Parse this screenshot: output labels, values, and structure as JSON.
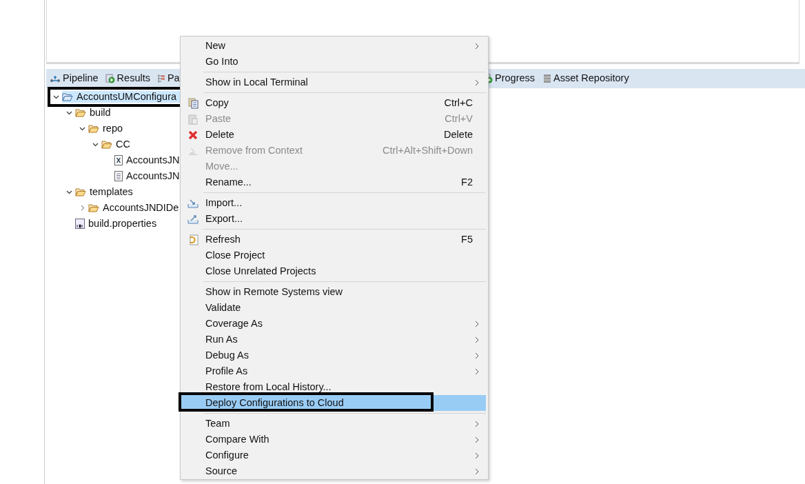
{
  "view_tabs": {
    "left": [
      {
        "label": "Pipeline",
        "kind": "pipeline"
      },
      {
        "label": "Results",
        "kind": "results"
      },
      {
        "label": "Pa",
        "kind": "grid"
      }
    ],
    "right": [
      {
        "label": "Progress",
        "kind": "results"
      },
      {
        "label": "Asset Repository",
        "kind": "repo"
      }
    ]
  },
  "tree": [
    {
      "label": "AccountsUMConfigura",
      "kind": "project",
      "expanded": true,
      "selected": true,
      "children": [
        {
          "label": "build",
          "kind": "folder",
          "expanded": true,
          "selected": false,
          "children": [
            {
              "label": "repo",
              "kind": "folder",
              "expanded": true,
              "selected": false,
              "children": [
                {
                  "label": "CC",
                  "kind": "folder",
                  "expanded": true,
                  "selected": false,
                  "children": [
                    {
                      "label": "AccountsJN",
                      "kind": "xml",
                      "selected": false
                    },
                    {
                      "label": "AccountsJN",
                      "kind": "text",
                      "selected": false
                    }
                  ]
                }
              ]
            }
          ]
        },
        {
          "label": "templates",
          "kind": "folder",
          "expanded": true,
          "selected": false,
          "children": [
            {
              "label": "AccountsJNDIDe",
              "kind": "folder",
              "expanded": false,
              "selected": false
            }
          ]
        },
        {
          "label": "build.properties",
          "kind": "binary",
          "selected": false
        }
      ]
    }
  ],
  "context_menu": {
    "groups": [
      [
        {
          "label": "New",
          "submenu": true,
          "disabled": false,
          "selected": false
        },
        {
          "label": "Go Into",
          "submenu": false,
          "disabled": false,
          "selected": false
        }
      ],
      [
        {
          "label": "Show in Local Terminal",
          "submenu": true,
          "disabled": false,
          "selected": false
        }
      ],
      [
        {
          "label": "Copy",
          "kind": "copy",
          "shortcut": "Ctrl+C",
          "submenu": false,
          "disabled": false,
          "selected": false
        },
        {
          "label": "Paste",
          "kind": "paste",
          "shortcut": "Ctrl+V",
          "submenu": false,
          "disabled": true,
          "selected": false
        },
        {
          "label": "Delete",
          "kind": "delete",
          "shortcut": "Delete",
          "submenu": false,
          "disabled": false,
          "selected": false
        },
        {
          "label": "Remove from Context",
          "kind": "remove",
          "shortcut": "Ctrl+Alt+Shift+Down",
          "submenu": false,
          "disabled": true,
          "selected": false
        },
        {
          "label": "Move...",
          "submenu": false,
          "disabled": true,
          "selected": false
        },
        {
          "label": "Rename...",
          "shortcut": "F2",
          "submenu": false,
          "disabled": false,
          "selected": false
        }
      ],
      [
        {
          "label": "Import...",
          "kind": "import",
          "submenu": false,
          "disabled": false,
          "selected": false
        },
        {
          "label": "Export...",
          "kind": "export",
          "submenu": false,
          "disabled": false,
          "selected": false
        }
      ],
      [
        {
          "label": "Refresh",
          "kind": "refresh",
          "shortcut": "F5",
          "submenu": false,
          "disabled": false,
          "selected": false
        },
        {
          "label": "Close Project",
          "submenu": false,
          "disabled": false,
          "selected": false
        },
        {
          "label": "Close Unrelated Projects",
          "submenu": false,
          "disabled": false,
          "selected": false
        }
      ],
      [
        {
          "label": "Show in Remote Systems view",
          "submenu": false,
          "disabled": false,
          "selected": false
        },
        {
          "label": "Validate",
          "submenu": false,
          "disabled": false,
          "selected": false
        },
        {
          "label": "Coverage As",
          "submenu": true,
          "disabled": false,
          "selected": false
        },
        {
          "label": "Run As",
          "submenu": true,
          "disabled": false,
          "selected": false
        },
        {
          "label": "Debug As",
          "submenu": true,
          "disabled": false,
          "selected": false
        },
        {
          "label": "Profile As",
          "submenu": true,
          "disabled": false,
          "selected": false
        },
        {
          "label": "Restore from Local History...",
          "submenu": false,
          "disabled": false,
          "selected": false
        },
        {
          "label": "Deploy Configurations to Cloud",
          "submenu": false,
          "disabled": false,
          "selected": true
        }
      ],
      [
        {
          "label": "Team",
          "submenu": true,
          "disabled": false,
          "selected": false
        },
        {
          "label": "Compare With",
          "submenu": true,
          "disabled": false,
          "selected": false
        },
        {
          "label": "Configure",
          "submenu": true,
          "disabled": false,
          "selected": false
        },
        {
          "label": "Source",
          "submenu": true,
          "disabled": false,
          "selected": false
        }
      ]
    ]
  }
}
